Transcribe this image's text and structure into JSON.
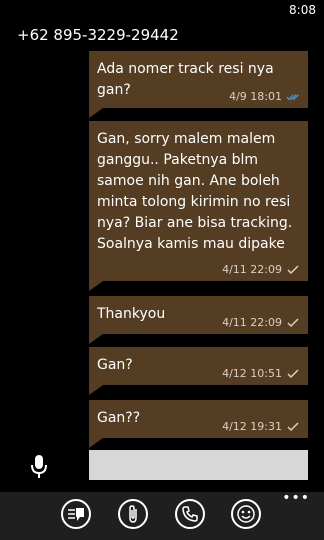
{
  "status": {
    "time": "8:08"
  },
  "conversation": {
    "contact": "+62 895-3229-29442",
    "messages": [
      {
        "text": "Ada nomer track resi nya gan?",
        "timestamp": "4/9 18:01",
        "status": "read"
      },
      {
        "text": "Gan, sorry malem malem ganggu.. Paketnya blm samoe nih gan. Ane boleh minta tolong kirimin no resi nya? Biar ane bisa tracking. Soalnya kamis mau dipake",
        "timestamp": "4/11 22:09",
        "status": "sent"
      },
      {
        "text": "Thankyou",
        "timestamp": "4/11 22:09",
        "status": "sent"
      },
      {
        "text": "Gan?",
        "timestamp": "4/12 10:51",
        "status": "sent"
      },
      {
        "text": "Gan??",
        "timestamp": "4/12 19:31",
        "status": "sent"
      }
    ]
  },
  "composer": {
    "value": "",
    "mic_icon": "microphone-icon"
  },
  "appbar": {
    "buttons": [
      {
        "icon": "switch-conversation-icon"
      },
      {
        "icon": "attach-icon"
      },
      {
        "icon": "call-icon"
      },
      {
        "icon": "emoji-icon"
      }
    ],
    "more": "•••"
  },
  "colors": {
    "bubble": "#543d23",
    "background": "#000000",
    "read_check": "#4a9bd8"
  }
}
